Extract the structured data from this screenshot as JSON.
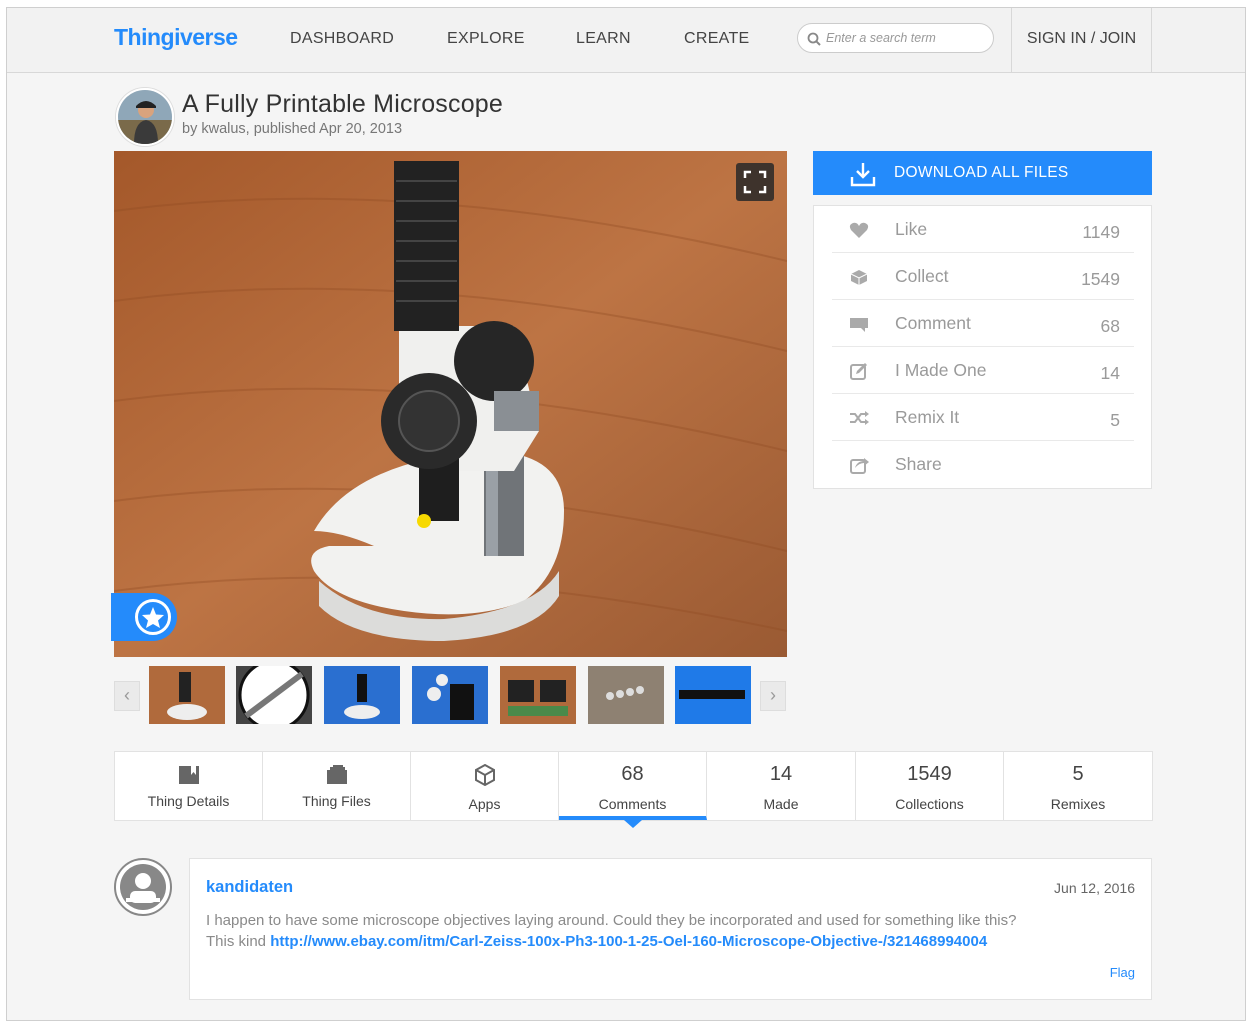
{
  "header": {
    "logo": "Thingiverse",
    "nav": [
      "DASHBOARD",
      "EXPLORE",
      "LEARN",
      "CREATE"
    ],
    "search_placeholder": "Enter a search term",
    "signin": "SIGN IN / JOIN"
  },
  "thing": {
    "title": "A Fully Printable Microscope",
    "byline": "by kwalus, published Apr 20, 2013"
  },
  "download_label": "DOWNLOAD ALL FILES",
  "actions": [
    {
      "label": "Like",
      "count": "1149",
      "icon": "heart-icon"
    },
    {
      "label": "Collect",
      "count": "1549",
      "icon": "collect-icon"
    },
    {
      "label": "Comment",
      "count": "68",
      "icon": "comment-icon"
    },
    {
      "label": "I Made One",
      "count": "14",
      "icon": "made-one-icon"
    },
    {
      "label": "Remix It",
      "count": "5",
      "icon": "remix-icon"
    },
    {
      "label": "Share",
      "count": "",
      "icon": "share-icon"
    }
  ],
  "tabs": [
    {
      "label": "Thing Details",
      "icon": "details-icon"
    },
    {
      "label": "Thing Files",
      "icon": "files-icon"
    },
    {
      "label": "Apps",
      "icon": "apps-icon"
    },
    {
      "num": "68",
      "label": "Comments"
    },
    {
      "num": "14",
      "label": "Made"
    },
    {
      "num": "1549",
      "label": "Collections"
    },
    {
      "num": "5",
      "label": "Remixes"
    }
  ],
  "comment": {
    "user": "kandidaten",
    "date": "Jun 12, 2016",
    "text": "I happen to have some microscope objectives laying around. Could they be incorporated and used for something like this?",
    "text2": "This kind ",
    "link": "http://www.ebay.com/itm/Carl-Zeiss-100x-Ph3-100-1-25-Oel-160-Microscope-Objective-/321468994004",
    "flag": "Flag"
  },
  "colors": {
    "accent": "#248bfb",
    "wood": "#b5683a"
  }
}
